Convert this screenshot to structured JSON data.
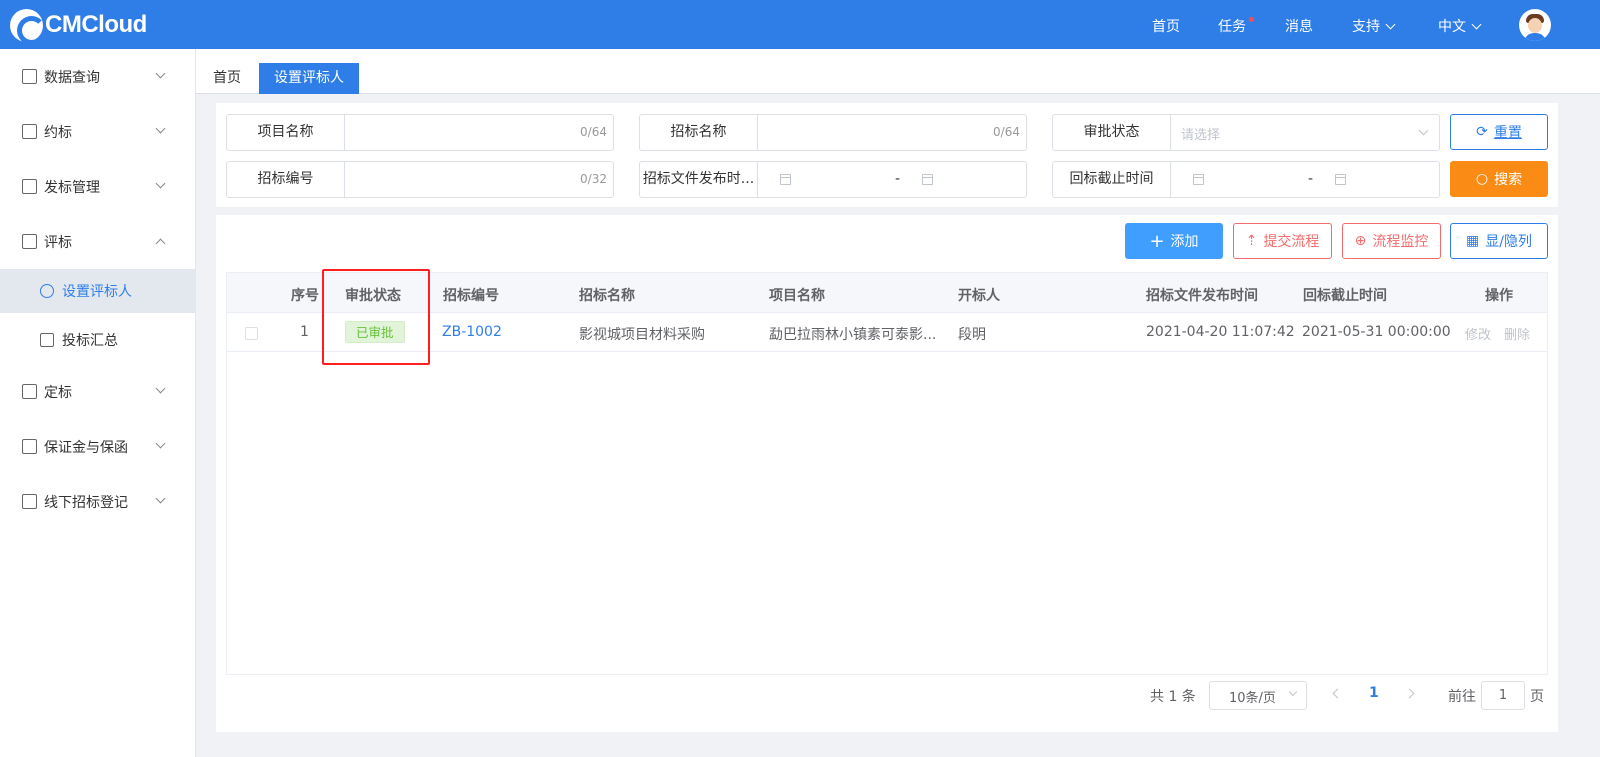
{
  "header": {
    "logo_text": "CMCloud",
    "nav": {
      "home": "首页",
      "tasks": "任务",
      "messages": "消息",
      "support": "支持",
      "language": "中文"
    },
    "accent_color": "#2f7ee8"
  },
  "sidebar": {
    "items": [
      {
        "label": "数据查询",
        "icon": "database-icon"
      },
      {
        "label": "约标",
        "icon": "coins-icon"
      },
      {
        "label": "发标管理",
        "icon": "document-icon"
      },
      {
        "label": "评标",
        "icon": "clipboard-check-icon"
      },
      {
        "label": "定标",
        "icon": "hand-icon"
      },
      {
        "label": "保证金与保函",
        "icon": "org-chart-icon"
      },
      {
        "label": "线下招标登记",
        "icon": "layers-icon"
      }
    ],
    "subitems": [
      {
        "label": "设置评标人",
        "icon": "user-settings-icon",
        "active": true
      },
      {
        "label": "投标汇总",
        "icon": "report-icon",
        "active": false
      }
    ]
  },
  "tabs": [
    {
      "label": "首页",
      "active": false
    },
    {
      "label": "设置评标人",
      "active": true
    }
  ],
  "filters": {
    "project_name": {
      "label": "项目名称",
      "count": "0/64"
    },
    "bid_name": {
      "label": "招标名称",
      "count": "0/64"
    },
    "approval_status": {
      "label": "审批状态",
      "placeholder": "请选择"
    },
    "bid_number": {
      "label": "招标编号",
      "count": "0/32"
    },
    "publish_time": {
      "label": "招标文件发布时...",
      "separator": "-"
    },
    "deadline": {
      "label": "回标截止时间",
      "separator": "-"
    },
    "reset_label": "重置",
    "search_label": "搜索"
  },
  "toolbar": {
    "add": "添加",
    "submit_flow": "提交流程",
    "flow_monitor": "流程监控",
    "toggle_columns": "显/隐列"
  },
  "table": {
    "columns": [
      "序号",
      "审批状态",
      "招标编号",
      "招标名称",
      "项目名称",
      "开标人",
      "招标文件发布时间",
      "回标截止时间",
      "操作"
    ],
    "rows": [
      {
        "index": "1",
        "status": "已审批",
        "bid_no": "ZB-1002",
        "bid_name": "影视城项目材料采购",
        "project_name": "勐巴拉雨林小镇素可泰影...",
        "opener": "段明",
        "publish_time": "2021-04-20 11:07:42",
        "deadline": "2021-05-31 00:00:00",
        "actions": {
          "edit": "修改",
          "delete": "删除"
        }
      }
    ]
  },
  "pagination": {
    "total": "共 1 条",
    "page_size": "10条/页",
    "current_page": "1",
    "goto_label": "前往",
    "goto_value": "1",
    "page_suffix": "页"
  }
}
